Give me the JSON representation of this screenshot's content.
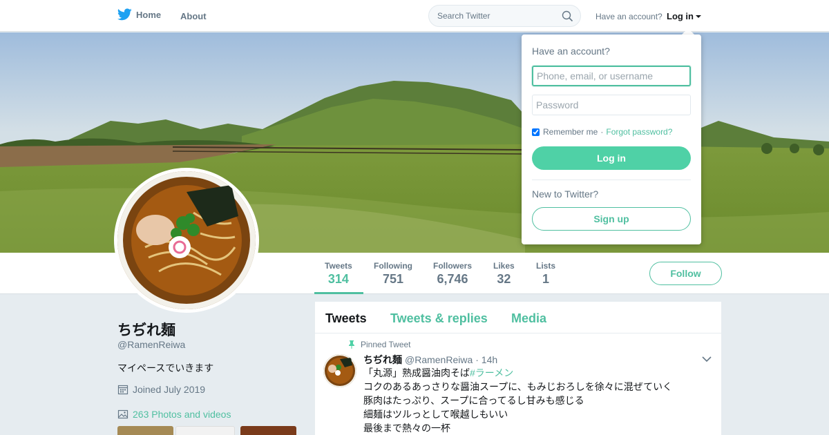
{
  "nav": {
    "home_label": "Home",
    "about_label": "About",
    "search_placeholder": "Search Twitter",
    "have_account": "Have an account?",
    "login_label": "Log in"
  },
  "colors": {
    "accent": "#4fbfa0",
    "brand_blue": "#1da1f2"
  },
  "profile": {
    "name": "ちぢれ麺",
    "handle": "@RamenReiwa",
    "bio": "マイペースでいきます",
    "joined": "Joined July 2019",
    "photos": "263 Photos and videos"
  },
  "stats": [
    {
      "label": "Tweets",
      "value": "314"
    },
    {
      "label": "Following",
      "value": "751"
    },
    {
      "label": "Followers",
      "value": "6,746"
    },
    {
      "label": "Likes",
      "value": "32"
    },
    {
      "label": "Lists",
      "value": "1"
    }
  ],
  "follow_label": "Follow",
  "timeline": {
    "tabs": [
      "Tweets",
      "Tweets & replies",
      "Media"
    ],
    "pinned_label": "Pinned Tweet",
    "tweet": {
      "name": "ちぢれ麺",
      "handle": "@RamenReiwa",
      "time": "· 14h",
      "line1": "「丸源」熟成醤油肉そば",
      "hashtag": "#ラーメン",
      "line2": "コクのあるあっさりな醤油スープに、もみじおろしを徐々に混ぜていく",
      "line3": "豚肉はたっぷり、スープに合ってるし甘みも感じる",
      "line4": "細麺はツルっとして喉越しもいい",
      "line5": "最後まで熱々の一杯"
    }
  },
  "login_dropdown": {
    "title": "Have an account?",
    "username_placeholder": "Phone, email, or username",
    "password_placeholder": "Password",
    "remember": "Remember me",
    "separator": "·",
    "forgot": "Forgot password?",
    "login_button": "Log in",
    "new_to": "New to Twitter?",
    "signup_button": "Sign up"
  },
  "icons": {
    "logo": "twitter-bird-icon",
    "search": "search-icon",
    "calendar": "calendar-icon",
    "photos": "photo-icon",
    "pin": "pin-icon",
    "chevron": "chevron-down-icon"
  }
}
